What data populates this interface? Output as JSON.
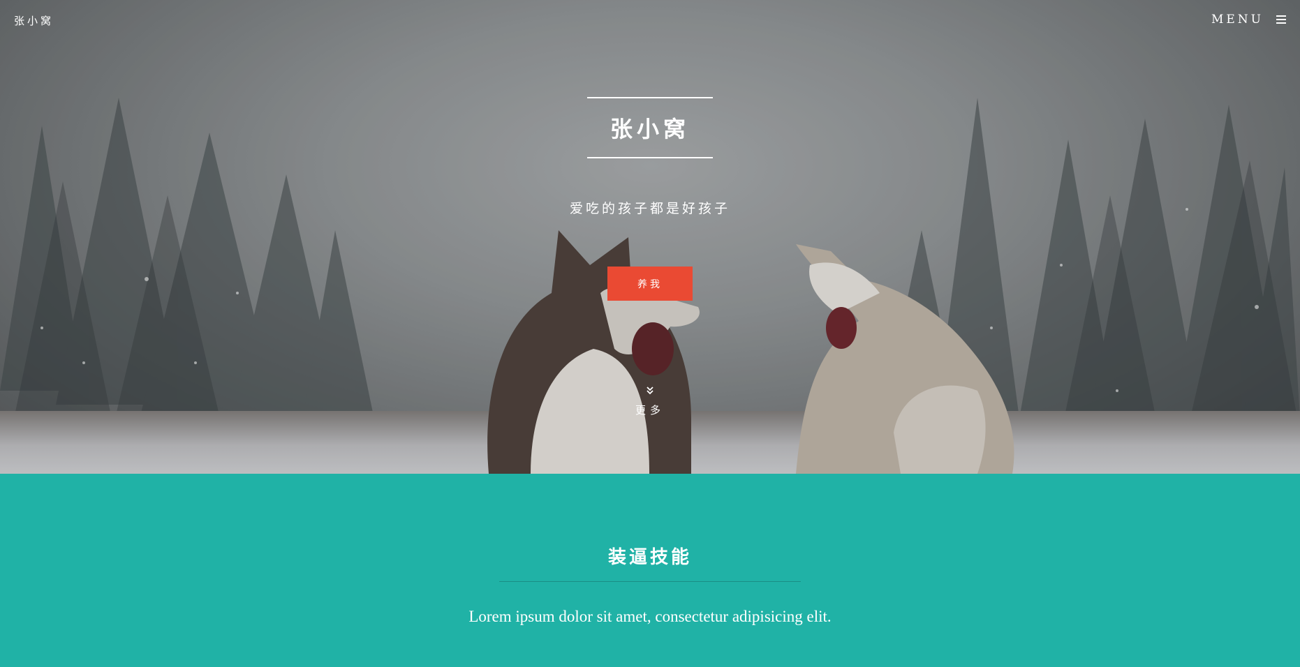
{
  "header": {
    "brand": "张小窝",
    "menu_label": "MENU",
    "menu_icon": "hamburger-icon"
  },
  "hero": {
    "title": "张小窝",
    "subtitle": "爱吃的孩子都是好孩子",
    "cta_label": "养我",
    "more_label": "更多",
    "more_icon": "double-chevron-down-icon",
    "background": "snowy-forest-two-huskies-photo"
  },
  "skills": {
    "title": "装逼技能",
    "text": "Lorem ipsum dolor sit amet, consectetur adipisicing elit."
  },
  "colors": {
    "accent": "#ea4a33",
    "section_bg": "#20b2a6",
    "rule": "#1a8e85"
  }
}
